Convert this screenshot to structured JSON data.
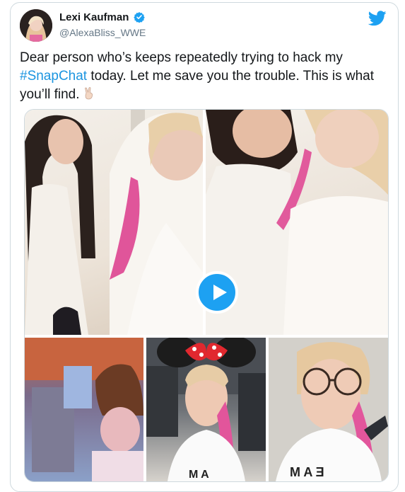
{
  "tweet": {
    "author_name": "Lexi Kaufman",
    "author_handle": "@AlexaBliss_WWE",
    "text_before": "Dear person who’s keeps repeatedly trying to hack my ",
    "hashtag": "#SnapChat",
    "text_after": " today. Let me save you the trouble. This is what you’ll find. ",
    "emoji": "victory-hand"
  },
  "media": {
    "tiles": [
      "photo-two-women-bathrobes",
      "photo-two-women-closeup",
      "photo-blurry-room",
      "photo-minnie-ears-filter",
      "photo-glasses-selfie"
    ],
    "video_overlay": "play-button"
  },
  "colors": {
    "link": "#1b95e0",
    "verified": "#1da1f2",
    "twitter_blue": "#1da1f2",
    "text": "#14171a",
    "muted": "#657786",
    "border": "#cfd9de"
  }
}
